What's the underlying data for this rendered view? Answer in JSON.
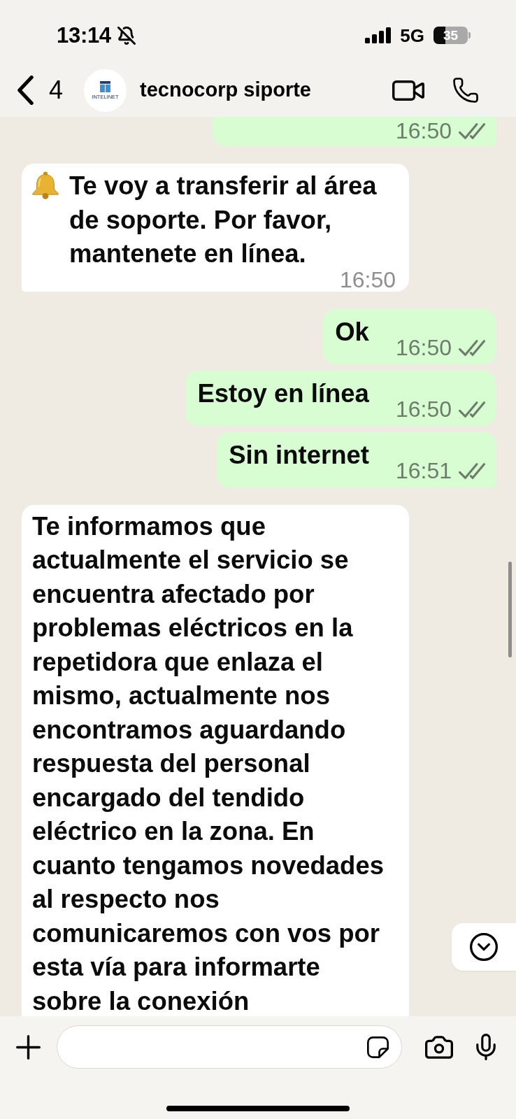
{
  "status_bar": {
    "time": "13:14",
    "silent": true,
    "network": "5G",
    "battery": "35"
  },
  "header": {
    "back_count": "4",
    "avatar_label": "INTELINET",
    "title": "tecnocorp siporte"
  },
  "messages": [
    {
      "kind": "clipped",
      "outgoing": true,
      "time": "16:50",
      "read": false
    },
    {
      "kind": "notice",
      "outgoing": false,
      "text": "Te voy a transferir al área de soporte. Por favor, mantenete en línea.",
      "time": "16:50"
    },
    {
      "kind": "text",
      "outgoing": true,
      "text": "Ok",
      "time": "16:50",
      "read": false
    },
    {
      "kind": "text",
      "outgoing": true,
      "text": "Estoy en línea",
      "time": "16:50",
      "read": false
    },
    {
      "kind": "text",
      "outgoing": true,
      "text": "Sin internet",
      "time": "16:51",
      "read": false
    },
    {
      "kind": "text",
      "outgoing": false,
      "text": "Te informamos que actualmente el servicio se encuentra afectado por problemas eléctricos en la repetidora que enlaza el mismo, actualmente nos encontramos aguardando respuesta del personal encargado del tendido eléctrico en la zona. En cuanto tengamos novedades al respecto nos comunicaremos con vos por esta vía para informarte sobre la conexión"
    }
  ]
}
